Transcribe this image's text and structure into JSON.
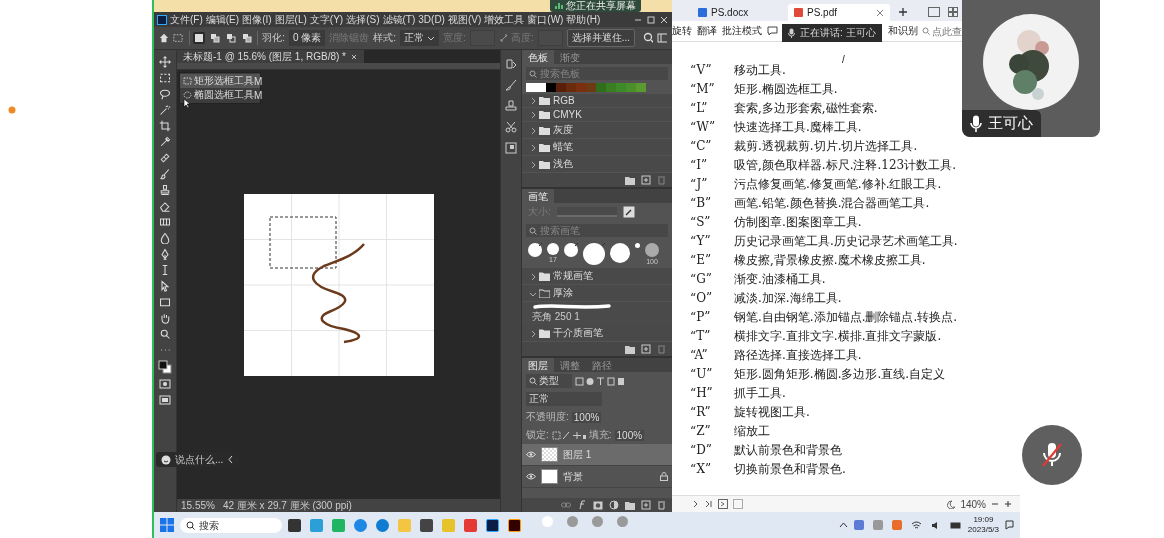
{
  "meeting": {
    "share_badge": "您正在共享屏幕",
    "speaking_toast": "正在讲话: 王可心",
    "participant_name": "王可心",
    "chat_placeholder": "说点什么...",
    "mic_muted": true,
    "pages": [
      {
        "selected": true
      },
      {
        "selected": false
      },
      {
        "selected": false
      },
      {
        "selected": false
      }
    ]
  },
  "photoshop": {
    "menu": [
      "文件(F)",
      "编辑(E)",
      "图像(I)",
      "图层(L)",
      "文字(Y)",
      "选择(S)",
      "滤镜(T)",
      "3D(D)",
      "视图(V)",
      "增效工具",
      "窗口(W)",
      "帮助(H)"
    ],
    "options": {
      "modes": [
        {
          "selected": true
        },
        {
          "selected": false
        },
        {
          "selected": false
        },
        {
          "selected": false
        }
      ],
      "feather_label": "羽化:",
      "feather_value": "0 像素",
      "antialias": {
        "label": "消除锯齿",
        "disabled": true
      },
      "style_label": "样式:",
      "style_value": "正常",
      "width_label": "宽度:",
      "height_label": "高度:",
      "size_disabled": true,
      "select_mask": "选择并遮住..."
    },
    "document_tab": "未标题-1 @ 15.6% (图层 1, RGB/8) *",
    "tool_flyout": [
      {
        "label": "矩形选框工具",
        "shortcut": "M",
        "selected": true
      },
      {
        "label": "椭圆选框工具",
        "shortcut": "M",
        "selected": false
      }
    ],
    "status": {
      "zoom": "15.55%",
      "doc_size": "42 厘米 x 29.7 厘米 (300 ppi)"
    },
    "swatches_panel": {
      "tabs": [
        {
          "label": "色板",
          "selected": true
        },
        {
          "label": "渐变",
          "selected": false
        }
      ],
      "search_placeholder": "搜索色板",
      "swatches": [
        {
          "color": "#ffffff"
        },
        {
          "color": "#ffffff"
        },
        {
          "color": "#000000"
        },
        {
          "color": "#5a1e0a"
        },
        {
          "color": "#6b2a0c"
        },
        {
          "color": "#7a3010"
        },
        {
          "color": "#6e3a14"
        },
        {
          "color": "#2f6e1c"
        },
        {
          "color": "#3a7d22"
        },
        {
          "color": "#3f8a28"
        },
        {
          "color": "#4a8f2a"
        },
        {
          "color": "#5a9a30"
        }
      ],
      "folders": [
        {
          "label": "RGB",
          "expanded": false
        },
        {
          "label": "CMYK",
          "expanded": false
        },
        {
          "label": "灰度",
          "expanded": false
        },
        {
          "label": "蜡笔",
          "expanded": false
        },
        {
          "label": "浅色",
          "expanded": false
        }
      ]
    },
    "brush_panel": {
      "tab": "画笔",
      "size_label": "大小:",
      "search_placeholder": "搜索画笔",
      "tips": [
        {
          "kind": "pressure"
        },
        {
          "kind": "round",
          "label": "17"
        },
        {
          "kind": "pressure"
        },
        {
          "kind": "pressure"
        },
        {
          "kind": "round"
        },
        {
          "kind": "round"
        },
        {
          "kind": "soft",
          "label": "100"
        }
      ],
      "folders": [
        {
          "label": "常规画笔",
          "expanded": false
        },
        {
          "label": "厚涂",
          "expanded": true,
          "children": [
            {
              "label": "亮角 250 1"
            }
          ]
        },
        {
          "label": "干介质画笔",
          "expanded": false
        }
      ]
    },
    "layers_panel": {
      "tabs": [
        {
          "label": "图层",
          "selected": true
        },
        {
          "label": "调整",
          "selected": false
        },
        {
          "label": "路径",
          "selected": false
        }
      ],
      "filter": "类型",
      "blend_mode": "正常",
      "opacity_label": "不透明度:",
      "opacity": "100%",
      "lock_label": "锁定:",
      "fill_label": "填充:",
      "fill": "100%",
      "layers": [
        {
          "name": "图层 1",
          "kind": "pixel",
          "selected": true,
          "visible": true,
          "locked": false
        },
        {
          "name": "背景",
          "kind": "background",
          "selected": false,
          "visible": true,
          "locked": true
        }
      ]
    }
  },
  "pdf_viewer": {
    "tabs": [
      {
        "label": "PS.docx",
        "kind": "word",
        "selected": false
      },
      {
        "label": "PS.pdf",
        "kind": "pdf",
        "selected": true
      }
    ],
    "toolbar": [
      "旋转",
      "翻译",
      "批注模式"
    ],
    "ocr_label": "和识别",
    "search_placeholder": "点此查",
    "page_mark": "/",
    "notes": [
      {
        "key": "“V”",
        "text": "移动工具."
      },
      {
        "key": "“M”",
        "text": "矩形.椭圆选框工具."
      },
      {
        "key": "“L”",
        "text": "套索,多边形套索,磁性套索."
      },
      {
        "key": "“W”",
        "text": "快速选择工具.魔棒工具."
      },
      {
        "key": "“C”",
        "text": "裁剪.透视裁剪.切片.切片选择工具."
      },
      {
        "key": "“I”",
        "text": "吸管,颜色取样器.标尺.注释.123计数工具."
      },
      {
        "key": "“J”",
        "text": "污点修复画笔.修复画笔.修补.红眼工具."
      },
      {
        "key": "“B”",
        "text": "画笔.铅笔.颜色替换.混合器画笔工具."
      },
      {
        "key": "“S”",
        "text": "仿制图章.图案图章工具."
      },
      {
        "key": "“Y”",
        "text": "历史记录画笔工具.历史记录艺术画笔工具."
      },
      {
        "key": "“E”",
        "text": "橡皮擦,背景橡皮擦.魔术橡皮擦工具."
      },
      {
        "key": "“G”",
        "text": "渐变.油漆桶工具."
      },
      {
        "key": "“O”",
        "text": "减淡.加深.海绵工具."
      },
      {
        "key": "“P”",
        "text": "钢笔.自由钢笔.添加锚点.删除锚点.转换点."
      },
      {
        "key": "“T”",
        "text": "横排文字.直排文字.横排.直排文字蒙版."
      },
      {
        "key": "“A”",
        "text": "路径选择.直接选择工具."
      },
      {
        "key": "“U”",
        "text": "矩形.圆角矩形.椭圆.多边形.直线.自定义"
      },
      {
        "key": "“H”",
        "text": "抓手工具."
      },
      {
        "key": "“R”",
        "text": "旋转视图工具."
      },
      {
        "key": "“Z”",
        "text": "缩放工"
      },
      {
        "key": "“D”",
        "text": "默认前景色和背景色"
      },
      {
        "key": "“X”",
        "text": "切换前景色和背景色."
      }
    ],
    "zoom": "140%"
  },
  "taskbar": {
    "search_placeholder": "搜索",
    "time": "19:09",
    "date": "2023/5/3"
  }
}
